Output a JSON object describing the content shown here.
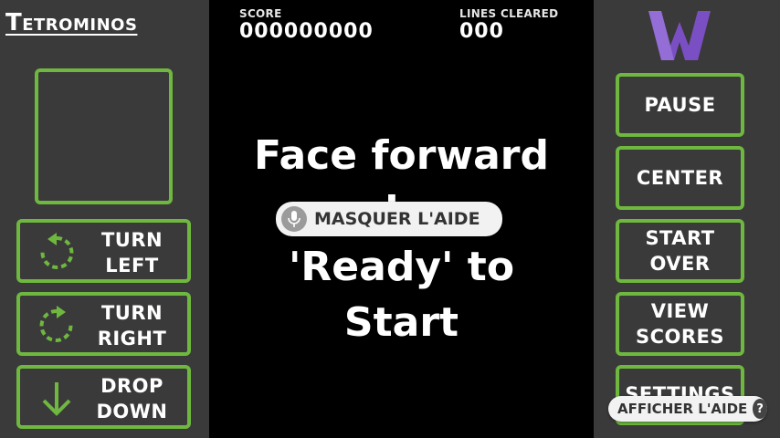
{
  "game": {
    "title": "Tetrominos"
  },
  "hud": {
    "score_label": "SCORE",
    "score_value": "000000000",
    "lines_label": "LINES CLEARED",
    "lines_value": "000"
  },
  "prompt": {
    "line1": "Face forward",
    "line2": "and say",
    "line3": "'Ready' to",
    "line4": "Start"
  },
  "left_controls": [
    {
      "line1": "TURN",
      "line2": "LEFT",
      "icon": "rotate-left-icon"
    },
    {
      "line1": "TURN",
      "line2": "RIGHT",
      "icon": "rotate-right-icon"
    },
    {
      "line1": "DROP",
      "line2": "DOWN",
      "icon": "arrow-down-icon"
    }
  ],
  "right_controls": [
    {
      "line1": "PAUSE"
    },
    {
      "line1": "CENTER"
    },
    {
      "line1": "START",
      "line2": "OVER"
    },
    {
      "line1": "VIEW",
      "line2": "SCORES"
    },
    {
      "line1": "SETTINGS"
    }
  ],
  "overlays": {
    "hide_help": "MASQUER L'AIDE",
    "show_help": "AFFICHER L'AIDE",
    "help_glyph": "?"
  },
  "colors": {
    "accent_green": "#6fb83f",
    "panel": "#3a3a3a",
    "board": "#000000",
    "logo_purple": "#7b4fc4"
  }
}
